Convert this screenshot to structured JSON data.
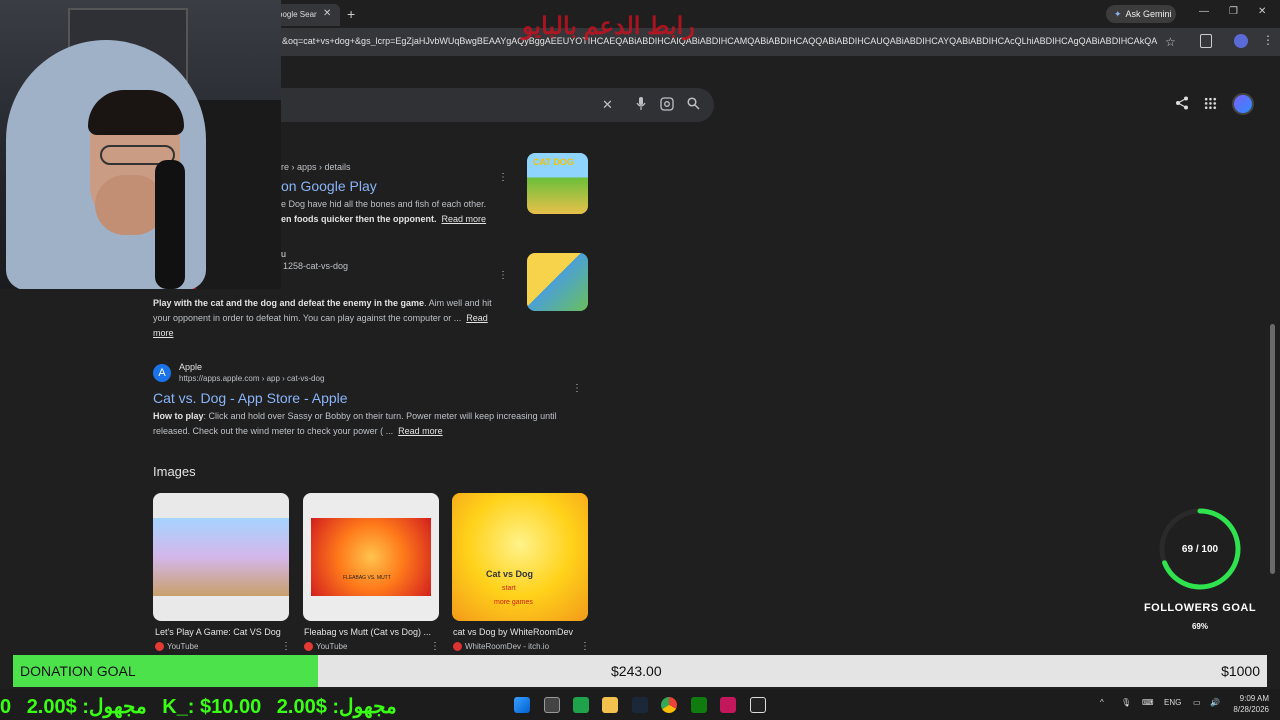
{
  "browser": {
    "tab_title": "oogle Sear",
    "gemini_label": "Ask Gemini",
    "url": "&oq=cat+vs+dog+&gs_lcrp=EgZjaHJvbWUqBwgBEAAYgAQyBggAEEUYOTIHCAEQABiABDIHCAIQABiABDIHCAMQABiABDIHCAQQABiABDIHCAUQABiABDIHCAYQABiABDIHCAcQLhiABDIHCAgQABiABDIHCAkQABi..."
  },
  "overlay": {
    "arabic_text": "رابط الدعم بالبايو"
  },
  "results": [
    {
      "breadcrumb": "re › apps › details",
      "title": "on Google Play",
      "snippet_line1": "e Dog have hid all the bones and fish of each other.",
      "snippet_line2_bold": "en foods quicker then the opponent.",
      "read_more": "Read more"
    },
    {
      "source": "u",
      "breadcrumb": "1258-cat-vs-dog",
      "snippet_bold": "Play with the cat and the dog and defeat the enemy in the game",
      "snippet_line1_rest": ". Aim well and hit",
      "snippet_line2": "your opponent in order to defeat him. You can play against the computer or ...",
      "read_more_1": "Read",
      "read_more_2": "more"
    },
    {
      "source": "Apple",
      "breadcrumb": "https://apps.apple.com › app › cat-vs-dog",
      "title": "Cat vs. Dog - App Store - Apple",
      "snippet_bold": "How to play",
      "snippet_line1_rest": ": Click and hold over Sassy or Bobby on their turn. Power meter will keep increasing until",
      "snippet_line2": "released. Check out the wind meter to check your power ( ...",
      "read_more": "Read more"
    }
  ],
  "thumb1_text": "CAT DOG",
  "images": {
    "heading": "Images",
    "cards": [
      {
        "caption": "Let's Play A Game: Cat VS Dog",
        "source": "YouTube"
      },
      {
        "caption": "Fleabag vs Mutt (Cat vs Dog) ...",
        "source": "YouTube",
        "inner_label": "FLEABAG VS. MUTT"
      },
      {
        "caption": "cat vs Dog by WhiteRoomDev",
        "source": "WhiteRoomDev - itch.io",
        "inner_title": "Cat vs Dog",
        "inner_start": "start",
        "inner_more": "more games"
      }
    ]
  },
  "followers_goal": {
    "count_text": "69 / 100",
    "label": "FOLLOWERS GOAL",
    "percent_text": "69%",
    "progress": 0.69,
    "color": "#2fe34f"
  },
  "donation_goal": {
    "label": "DONATION GOAL",
    "amount": "$243.00",
    "goal": "$1000",
    "progress": 0.243,
    "fill_color": "#4ce24c"
  },
  "ticker": [
    "0",
    "2.00$ :مجهول",
    "K_: $10.00",
    "2.00$ :مجهول"
  ],
  "tray": {
    "language": "ENG",
    "time": "9:09 AM",
    "date": "8/28/2026"
  }
}
